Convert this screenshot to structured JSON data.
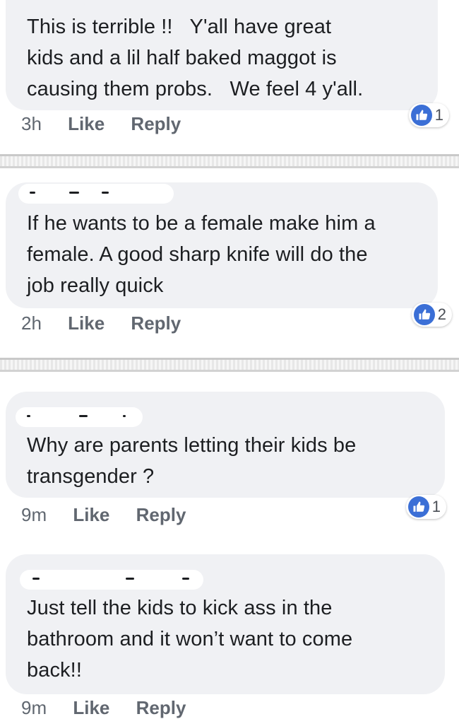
{
  "comments": [
    {
      "text": "This is terrible !!   Y'all have great\nkids and a lil half baked maggot is\ncausing them probs.   We feel 4 y'all.",
      "time": "3h",
      "like_label": "Like",
      "reply_label": "Reply",
      "reaction_count": "1"
    },
    {
      "text": "If he wants to be a female make him a\nfemale. A good sharp knife will do the\njob really quick",
      "time": "2h",
      "like_label": "Like",
      "reply_label": "Reply",
      "reaction_count": "2"
    },
    {
      "text": "Why are parents letting their kids be\ntransgender ?",
      "time": "9m",
      "like_label": "Like",
      "reply_label": "Reply",
      "reaction_count": "1"
    },
    {
      "text": "Just tell the kids to kick ass in the\nbathroom and it won’t want to come\nback!!",
      "time": "9m",
      "like_label": "Like",
      "reply_label": "Reply"
    }
  ],
  "colors": {
    "bubble": "#f0f1f4",
    "like_blue": "#3b6fd6",
    "meta_gray": "#606770"
  },
  "icons": {
    "reaction": "thumbs-up-icon"
  }
}
